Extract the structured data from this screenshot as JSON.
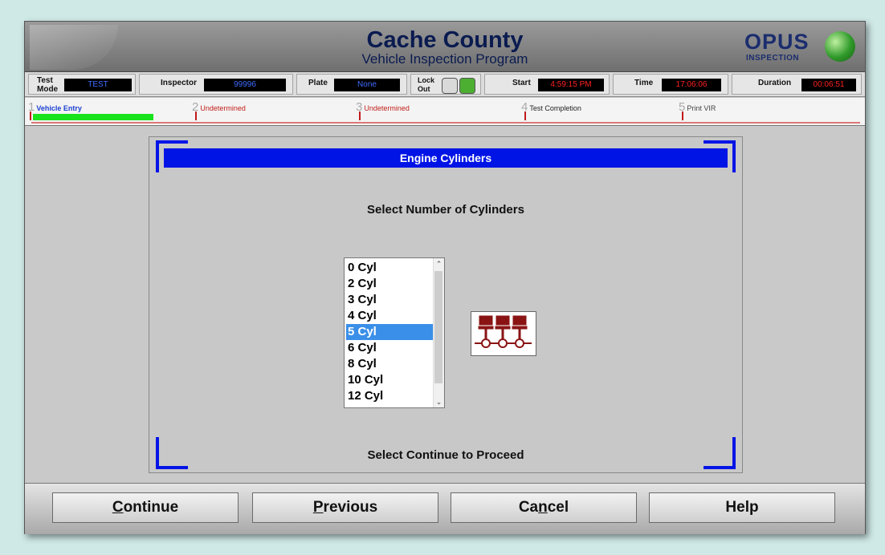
{
  "header": {
    "title": "Cache County",
    "subtitle": "Vehicle Inspection Program",
    "logo_word": "OPUS",
    "logo_sub": "INSPECTION"
  },
  "status": {
    "test_mode_label_1": "Test",
    "test_mode_label_2": "Mode",
    "test_mode_value": "TEST",
    "inspector_label": "Inspector",
    "inspector_value": "99996",
    "plate_label": "Plate",
    "plate_value": "None",
    "lockout_label_1": "Lock",
    "lockout_label_2": "Out",
    "start_label": "Start",
    "start_value": "4:59:15 PM",
    "time_label": "Time",
    "time_value": "17:06:06",
    "duration_label": "Duration",
    "duration_value": "00:06:51"
  },
  "steps": [
    {
      "num": "1",
      "label": "Vehicle Entry"
    },
    {
      "num": "2",
      "label": "Undetermined"
    },
    {
      "num": "3",
      "label": "Undetermined"
    },
    {
      "num": "4",
      "label": "Test Completion"
    },
    {
      "num": "5",
      "label": "Print VIR"
    }
  ],
  "dialog": {
    "title": "Engine Cylinders",
    "prompt": "Select Number of Cylinders",
    "footer": "Select Continue to Proceed",
    "options": [
      "0 Cyl",
      "2 Cyl",
      "3 Cyl",
      "4 Cyl",
      "5 Cyl",
      "6 Cyl",
      "8 Cyl",
      "10 Cyl",
      "12 Cyl"
    ],
    "selected": "5 Cyl"
  },
  "buttons": {
    "continue_hot": "C",
    "continue_rest": "ontinue",
    "previous_hot": "P",
    "previous_rest": "revious",
    "cancel_pre": "Ca",
    "cancel_hot": "n",
    "cancel_rest": "cel",
    "help": "Help"
  },
  "colors": {
    "accent_blue": "#0014e6",
    "progress_green": "#19e31c",
    "selection": "#3a8fe8"
  }
}
